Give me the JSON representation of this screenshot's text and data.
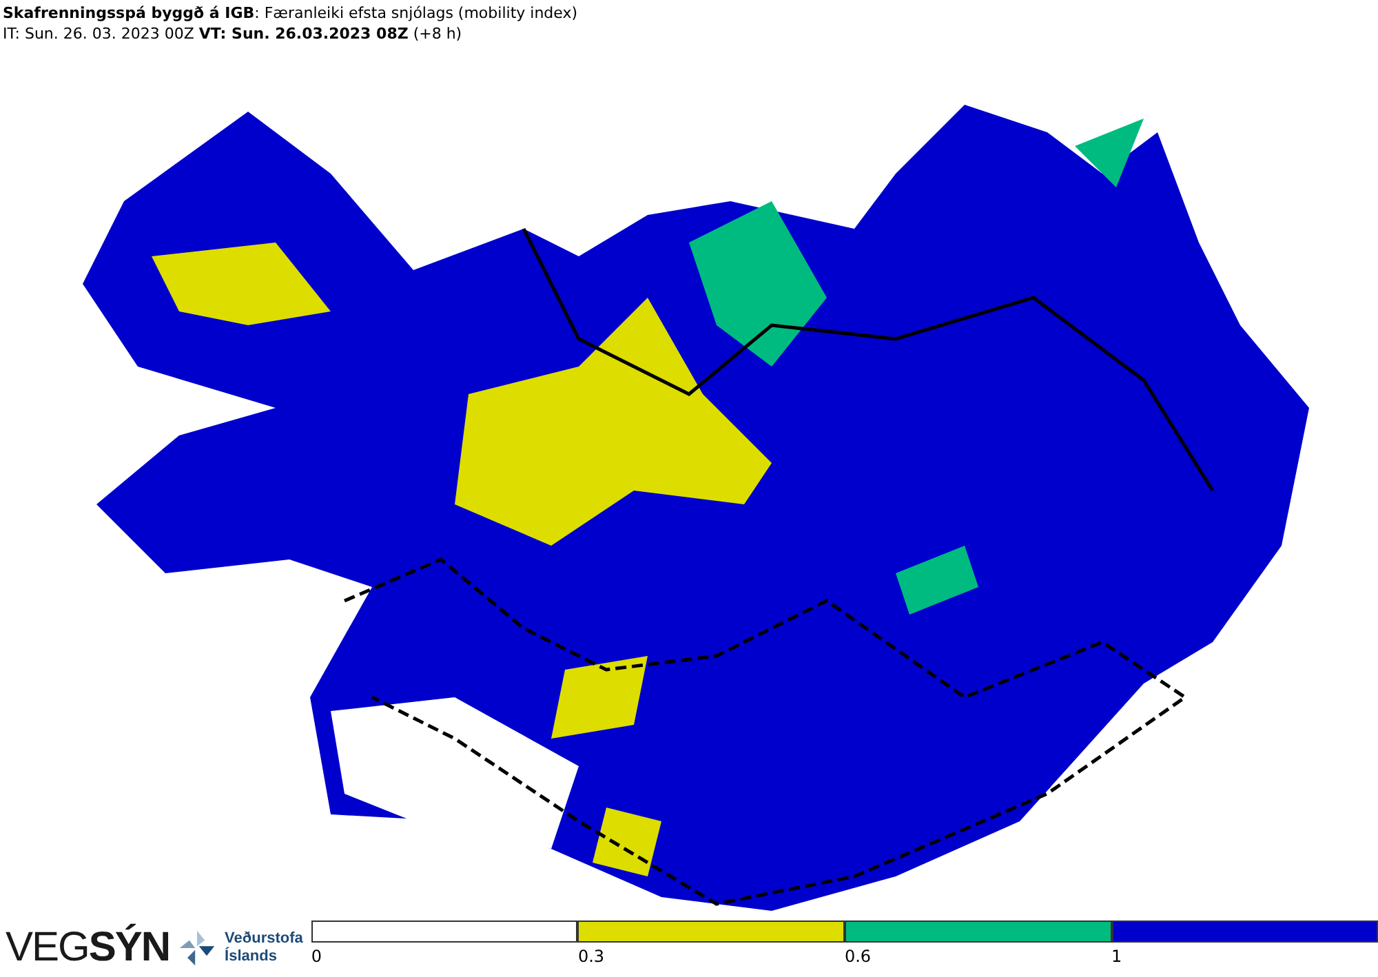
{
  "header": {
    "title": "**Skafrenningsspá byggð á IGB**: Færanleiki efsta snjólags (mobility index)",
    "subtitle": "IT: Sun. 26. 03. 2023 00Z **VT: Sun. 26.03.2023 08Z** (+8 h)"
  },
  "logos": {
    "vegsyn": "VEG**SÝN**",
    "vedurstofa_line_1": "Veðurstofa",
    "vedurstofa_line_2": "Íslands"
  },
  "legend": [
    {
      "label": "0",
      "color": "#ffffff"
    },
    {
      "label": "0.3",
      "color": "#dddd00"
    },
    {
      "label": "0.6",
      "color": "#00bb80"
    },
    {
      "label": "1",
      "color": "#0000cc"
    }
  ]
}
